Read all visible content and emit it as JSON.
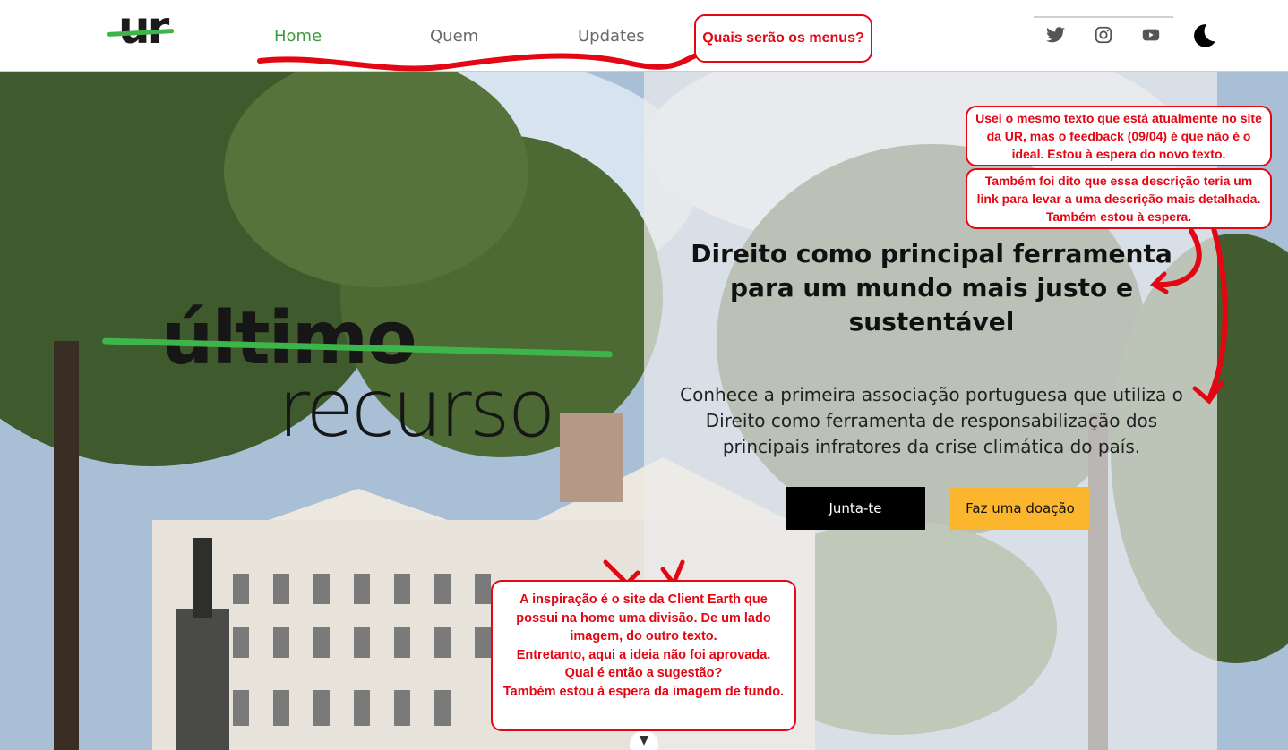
{
  "header": {
    "logo_text": "ur",
    "nav": [
      {
        "label": "Home",
        "active": true
      },
      {
        "label": "Quem",
        "active": false
      },
      {
        "label": "Updates",
        "active": false
      }
    ],
    "menu_question": "Quais serão os menus?",
    "social": [
      "twitter-icon",
      "instagram-icon",
      "youtube-icon"
    ],
    "theme_icon": "moon-icon"
  },
  "hero": {
    "brand_word1": "último",
    "brand_word2": "recurso",
    "title": "Direito como principal ferramenta para um mundo mais justo e sustentável",
    "description": "Conhece a primeira associação portuguesa que utiliza o Direito como ferramenta de responsabilização dos principais infratores da crise climática do país.",
    "button_join": "Junta-te",
    "button_donate": "Faz uma doação",
    "scroll_icon": "chevron-down-icon"
  },
  "annotations": {
    "note_text": "Usei o mesmo texto que está atualmente no site da UR, mas o feedback (09/04) é que não é o ideal. Estou à espera do novo texto.",
    "note_link": "Também foi dito que essa descrição teria um link para levar a uma descrição mais detalhada. Também estou à espera.",
    "note_inspiration": [
      "A inspiração é o site da Client Earth que possui na home uma divisão. De um lado imagem, do outro texto.",
      "Entretanto, aqui a ideia não foi aprovada.",
      "Qual é então a sugestão?",
      "Também estou à espera da imagem de fundo."
    ]
  },
  "colors": {
    "accent_green": "#3db54a",
    "nav_active": "#3e9a40",
    "annotation_red": "#e30613",
    "donate_yellow": "#fbb62d",
    "join_black": "#000000"
  }
}
